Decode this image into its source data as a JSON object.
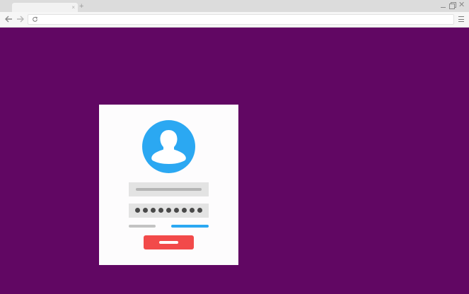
{
  "browser": {
    "tab": {
      "title": "",
      "close_glyph": "×"
    },
    "new_tab_glyph": "+",
    "window_controls": {
      "close_glyph": "✕"
    },
    "address_bar": {
      "value": "",
      "placeholder": ""
    },
    "icons": [
      "back-arrow-icon",
      "forward-arrow-icon",
      "reload-icon",
      "menu-icon",
      "minimize-icon",
      "restore-icon",
      "close-icon"
    ]
  },
  "page": {
    "background_color": "#610763",
    "login_card": {
      "avatar_icon": "user-silhouette-icon",
      "username_field": {
        "value": ""
      },
      "password_field": {
        "masked_dot_count": 9
      },
      "secondary_link_left": "",
      "secondary_link_right": "",
      "submit_button_label": ""
    }
  },
  "colors": {
    "page_background": "#610763",
    "accent_blue": "#2ba8f2",
    "accent_red": "#f24a4a",
    "card_background": "#fdfcfd",
    "field_background": "#e3e3e3"
  }
}
